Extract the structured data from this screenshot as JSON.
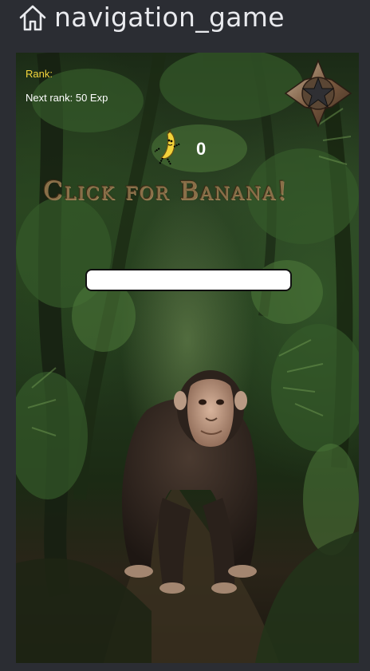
{
  "window": {
    "title": "navigation_game",
    "home_icon": "home-icon"
  },
  "game": {
    "rank_label": "Rank:",
    "next_rank_label": "Next rank: 50 Exp",
    "banana_count": "0",
    "banner_text": "Click for Banana!",
    "progress": 0,
    "icons": {
      "rank_badge": "star-cross-icon",
      "banana": "dancing-banana-icon",
      "chimp": "chimpanzee"
    },
    "colors": {
      "rank_label": "#f4d53c",
      "banner": "#8a6f48"
    }
  }
}
